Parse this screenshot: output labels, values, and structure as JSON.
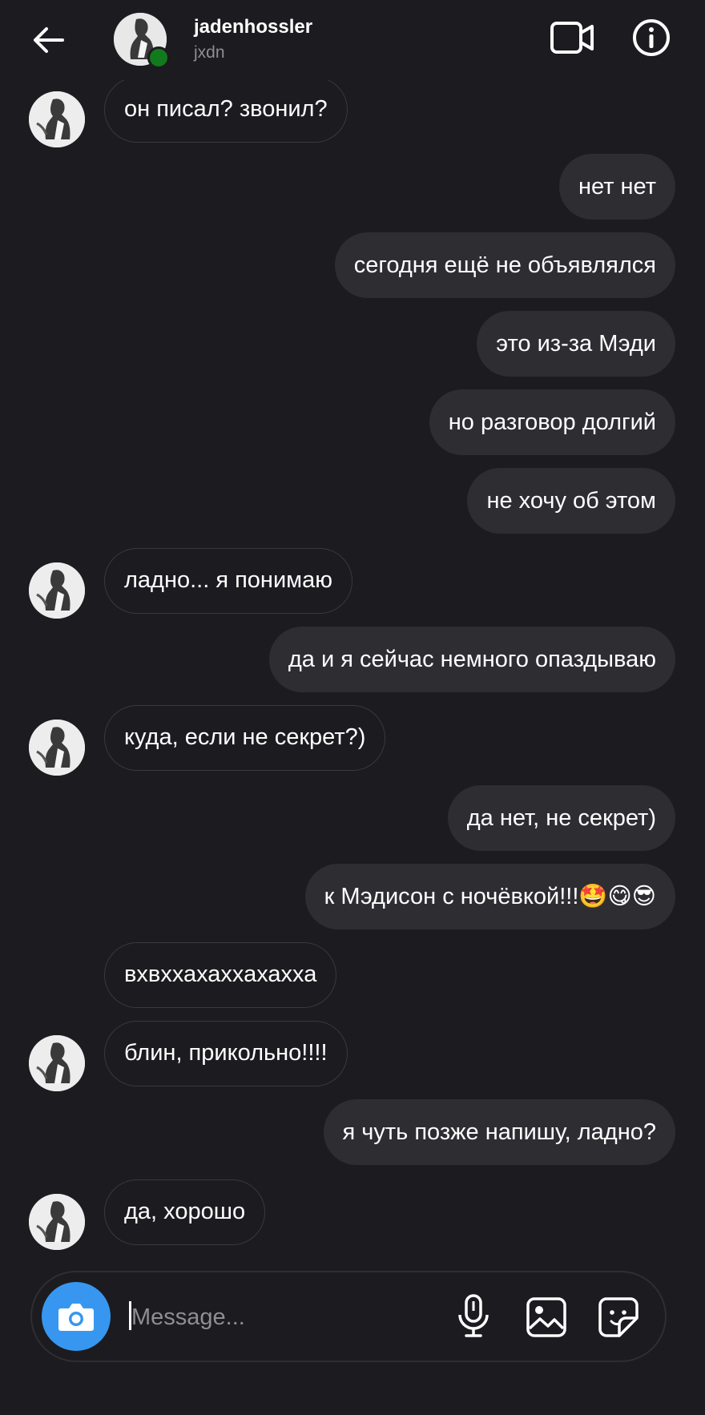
{
  "header": {
    "username": "jadenhossler",
    "subtitle": "jxdn",
    "icons": {
      "back": "back-arrow-icon",
      "video": "video-call-icon",
      "info": "info-icon"
    },
    "online_color": "#117a1d"
  },
  "messages": [
    {
      "side": "in",
      "text": "он писал? звонил?",
      "avatar": true
    },
    {
      "side": "out",
      "text": "нет нет"
    },
    {
      "side": "out",
      "text": "сегодня ещё не объявлялся"
    },
    {
      "side": "out",
      "text": "это из-за Мэди"
    },
    {
      "side": "out",
      "text": "но разговор долгий"
    },
    {
      "side": "out",
      "text": "не хочу об этом"
    },
    {
      "side": "in",
      "text": "ладно... я понимаю",
      "avatar": true
    },
    {
      "side": "out",
      "text": "да и я сейчас немного опаздываю"
    },
    {
      "side": "in",
      "text": "куда, если не секрет?)",
      "avatar": true
    },
    {
      "side": "out",
      "text": "да нет, не секрет)"
    },
    {
      "side": "out",
      "text": "к Мэдисон с ночёвкой!!!🤩😋😎"
    },
    {
      "side": "in",
      "text": "вхвххахаххахахха",
      "avatar": false
    },
    {
      "side": "in",
      "text": "блин, прикольно!!!!",
      "avatar": true
    },
    {
      "side": "out",
      "text": "я чуть позже напишу, ладно?"
    },
    {
      "side": "in",
      "text": "да, хорошо",
      "avatar": true
    }
  ],
  "composer": {
    "placeholder": "Message...",
    "icons": [
      "camera-icon",
      "microphone-icon",
      "gallery-icon",
      "sticker-icon"
    ],
    "camera_color": "#3797f0"
  }
}
